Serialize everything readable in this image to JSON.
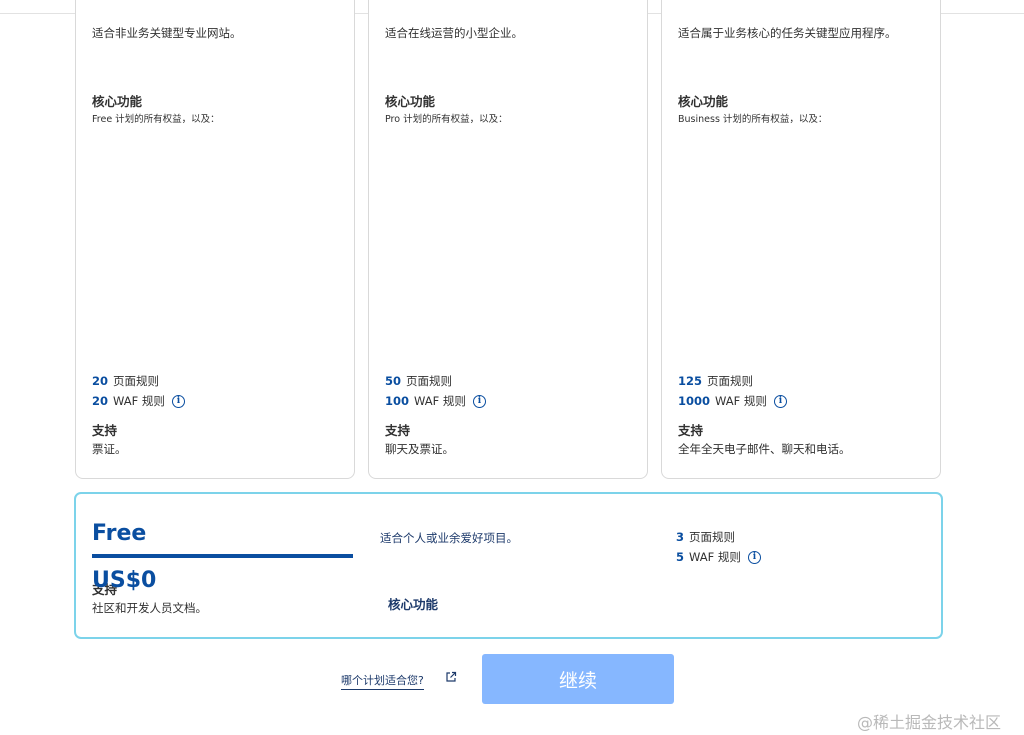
{
  "plans": [
    {
      "desc": "适合非业务关键型专业网站。",
      "core_title": "核心功能",
      "core_sub": "Free 计划的所有权益，以及：",
      "page_rules_num": "20",
      "page_rules_label": "页面规则",
      "waf_num": "20",
      "waf_label": "WAF 规则",
      "support_title": "支持",
      "support_text": "票证。"
    },
    {
      "desc": "适合在线运营的小型企业。",
      "core_title": "核心功能",
      "core_sub": "Pro 计划的所有权益，以及：",
      "page_rules_num": "50",
      "page_rules_label": "页面规则",
      "waf_num": "100",
      "waf_label": "WAF 规则",
      "support_title": "支持",
      "support_text": "聊天及票证。"
    },
    {
      "desc": "适合属于业务核心的任务关键型应用程序。",
      "core_title": "核心功能",
      "core_sub": "Business 计划的所有权益，以及：",
      "page_rules_num": "125",
      "page_rules_label": "页面规则",
      "waf_num": "1000",
      "waf_label": "WAF 规则",
      "support_title": "支持",
      "support_text": "全年全天电子邮件、聊天和电话。"
    }
  ],
  "free_plan": {
    "name": "Free",
    "price": "US$0",
    "support_title": "支持",
    "support_text": "社区和开发人员文档。",
    "desc": "适合个人或业余爱好项目。",
    "core_title": "核心功能",
    "page_rules_num": "3",
    "page_rules_label": "页面规则",
    "waf_num": "5",
    "waf_label": "WAF 规则"
  },
  "footer": {
    "help_link": "哪个计划适合您?",
    "continue_label": "继续"
  },
  "watermark": "@稀土掘金技术社区",
  "colors": {
    "accent": "#0a4ea0",
    "selected_border": "#7cd3ea",
    "button_disabled": "#86b7ff"
  }
}
